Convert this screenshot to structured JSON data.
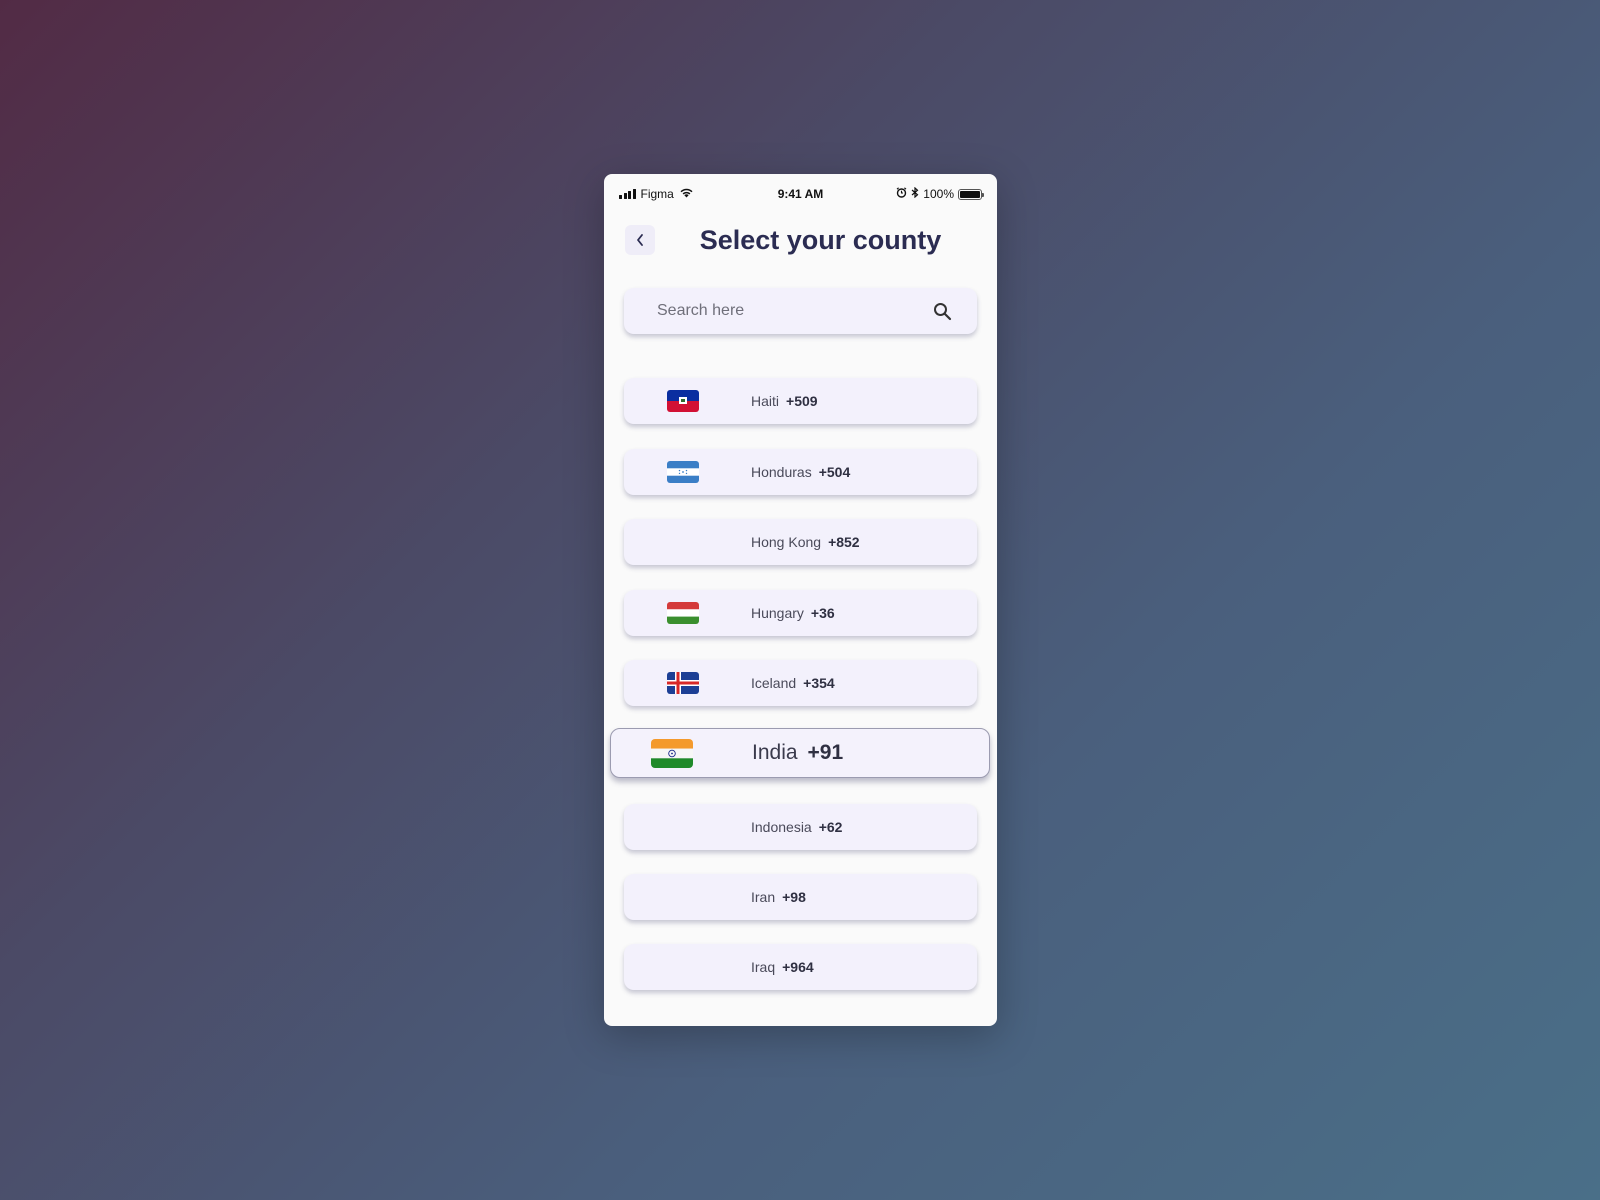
{
  "status_bar": {
    "carrier": "Figma",
    "time": "9:41 AM",
    "battery_percent": "100%",
    "battery_level": 1.0
  },
  "header": {
    "title": "Select your county",
    "back_icon": "chevron-left-icon"
  },
  "search": {
    "placeholder": "Search here",
    "value": "",
    "icon": "search-icon"
  },
  "countries": [
    {
      "name": "Haiti",
      "code": "+509",
      "flag": "haiti"
    },
    {
      "name": "Honduras",
      "code": "+504",
      "flag": "honduras"
    },
    {
      "name": "Hong Kong",
      "code": "+852",
      "flag": "none"
    },
    {
      "name": "Hungary",
      "code": "+36",
      "flag": "hungary"
    },
    {
      "name": "Iceland",
      "code": "+354",
      "flag": "iceland"
    },
    {
      "name": "India",
      "code": "+91",
      "flag": "india",
      "selected": true
    },
    {
      "name": "Indonesia",
      "code": "+62",
      "flag": "none"
    },
    {
      "name": "Iran",
      "code": "+98",
      "flag": "none"
    },
    {
      "name": "Iraq",
      "code": "+964",
      "flag": "none"
    }
  ],
  "colors": {
    "title": "#2b2c52",
    "row_background": "#f3f1fc",
    "phone_background": "#fafafa"
  }
}
